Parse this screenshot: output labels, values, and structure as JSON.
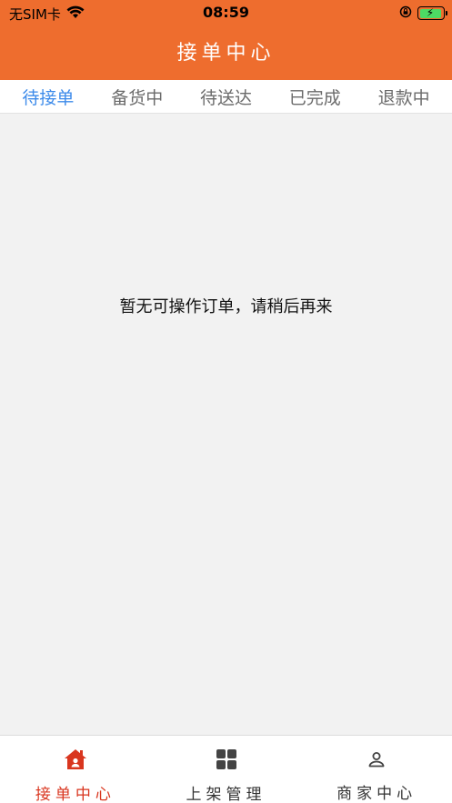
{
  "status_bar": {
    "carrier": "无SIM卡",
    "time": "08:59",
    "icons": [
      "wifi-icon",
      "orientation-lock-icon",
      "battery-charging-icon"
    ]
  },
  "header": {
    "title": "接单中心",
    "background_color": "#ee6d2e"
  },
  "tabs": [
    {
      "label": "待接单",
      "active": true
    },
    {
      "label": "备货中",
      "active": false
    },
    {
      "label": "待送达",
      "active": false
    },
    {
      "label": "已完成",
      "active": false
    },
    {
      "label": "退款中",
      "active": false
    }
  ],
  "content": {
    "empty_message": "暂无可操作订单，请稍后再来"
  },
  "tabbar": {
    "items": [
      {
        "label": "接单中心",
        "icon": "home-icon",
        "active": true
      },
      {
        "label": "上架管理",
        "icon": "grid-icon",
        "active": false
      },
      {
        "label": "商家中心",
        "icon": "user-icon",
        "active": false
      }
    ]
  },
  "colors": {
    "accent_active_tab": "#3d8bea",
    "tabbar_active": "#d9361f"
  }
}
